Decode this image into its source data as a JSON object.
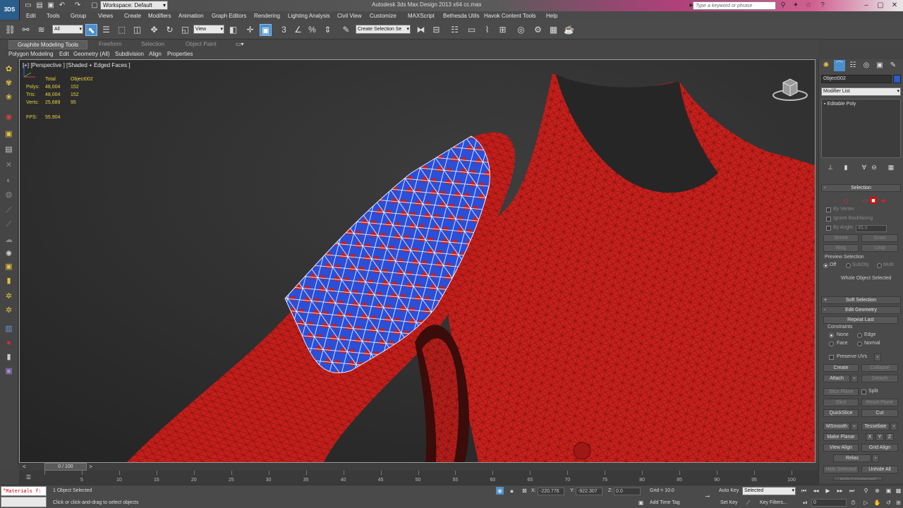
{
  "titlebar": {
    "logo_text": "3DS",
    "workspace": "Workspace: Default",
    "title": "Autodesk 3ds Max Design 2013 x64      cc.max",
    "search_placeholder": "Type a keyword or phrase"
  },
  "menu": [
    "Edit",
    "Tools",
    "Group",
    "Views",
    "Create",
    "Modifiers",
    "Animation",
    "Graph Editors",
    "Rendering",
    "Lighting Analysis",
    "Civil View",
    "Customize",
    "MAXScript",
    "Bethesda Utils",
    "Havok Content Tools",
    "Help"
  ],
  "toolbar": {
    "filter": "All",
    "ref_coord": "View",
    "named_selection": "Create Selection Se"
  },
  "ribbon": {
    "tabs": [
      "Graphite Modeling Tools",
      "Freeform",
      "Selection",
      "Object Paint"
    ],
    "subtabs": [
      "Polygon Modeling",
      "Edit",
      "Geometry (All)",
      "Subdivision",
      "Align",
      "Properties"
    ]
  },
  "viewport": {
    "label": "[+] [Perspective ] [Shaded + Edged Faces ]",
    "stats": {
      "col_total": "Total",
      "col_object": "Object002",
      "rows": [
        {
          "label": "Polys:",
          "total": "48,004",
          "obj": "152"
        },
        {
          "label": "Tris:",
          "total": "48,004",
          "obj": "152"
        },
        {
          "label": "Verts:",
          "total": "25,689",
          "obj": "95"
        }
      ],
      "fps_label": "FPS:",
      "fps_value": "55.904"
    },
    "colors": {
      "mesh": "#c8201c",
      "selection": "#2a4fd8",
      "background": "#2e2e2e"
    }
  },
  "command_panel": {
    "object_name": "Object002",
    "modifier_list": "Modifier List",
    "stack_item": "Editable Poly",
    "selection": {
      "title": "Selection",
      "by_vertex": "By Vertex",
      "ignore_backfacing": "Ignore Backfacing",
      "by_angle": "By Angle:",
      "angle_value": "45.0",
      "shrink": "Shrink",
      "grow": "Grow",
      "ring": "Ring",
      "loop": "Loop",
      "preview_title": "Preview Selection",
      "preview_off": "Off",
      "preview_subobj": "SubObj",
      "preview_multi": "Multi",
      "status": "Whole Object Selected"
    },
    "soft_selection": "Soft Selection",
    "edit_geometry": {
      "title": "Edit Geometry",
      "repeat_last": "Repeat Last",
      "constraints": "Constraints",
      "none": "None",
      "edge": "Edge",
      "face": "Face",
      "normal": "Normal",
      "preserve_uvs": "Preserve UVs",
      "create": "Create",
      "collapse": "Collapse",
      "attach": "Attach",
      "detach": "Detach",
      "slice_plane": "Slice Plane",
      "split": "Split",
      "slice": "Slice",
      "reset_plane": "Reset Plane",
      "quickslice": "QuickSlice",
      "cut": "Cut",
      "msmooth": "MSmooth",
      "tessellate": "Tessellate",
      "make_planar": "Make Planar",
      "x": "X",
      "y": "Y",
      "z": "Z",
      "view_align": "View Align",
      "grid_align": "Grid Align",
      "relax": "Relax",
      "hide_selected": "Hide Selected",
      "unhide_all": "Unhide All",
      "hide_unselected": "Hide Unselected"
    }
  },
  "timeline": {
    "slider": "0 / 100",
    "ticks": [
      "0",
      "5",
      "10",
      "15",
      "20",
      "25",
      "30",
      "35",
      "40",
      "45",
      "50",
      "55",
      "60",
      "65",
      "70",
      "75",
      "80",
      "85",
      "90",
      "95",
      "100"
    ]
  },
  "status": {
    "maxscript": "\"Materials f:",
    "selected": "1 Object Selected",
    "prompt": "Click or click-and-drag to select objects",
    "x_label": "X:",
    "x_value": "-220.776",
    "y_label": "Y:",
    "y_value": "-922.307",
    "z_label": "Z:",
    "z_value": "0.0",
    "grid": "Grid = 10.0",
    "add_time_tag": "Add Time Tag",
    "auto_key": "Auto Key",
    "auto_key_mode": "Selected",
    "set_key": "Set Key",
    "key_filters": "Key Filters...",
    "frame": "0"
  }
}
